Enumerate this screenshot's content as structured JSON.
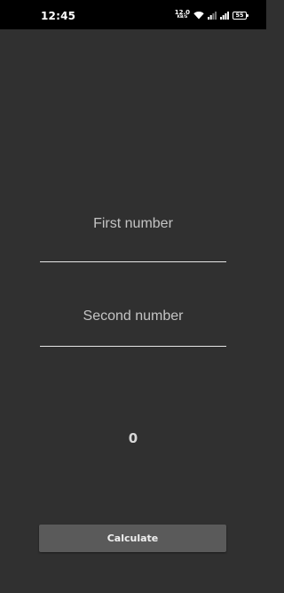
{
  "status_bar": {
    "time": "12:45",
    "net_speed_value": "12.0",
    "net_speed_unit": "KB/S",
    "battery_level": "55",
    "icons": [
      "wifi-icon",
      "signal-icon",
      "signal-icon",
      "battery-icon"
    ]
  },
  "form": {
    "first_number_placeholder": "First number",
    "first_number_value": "",
    "second_number_placeholder": "Second number",
    "second_number_value": ""
  },
  "result": {
    "value": "0"
  },
  "actions": {
    "calculate_label": "Calculate"
  },
  "colors": {
    "background": "#303030",
    "status_bar": "#000000",
    "button": "#5a5a5a",
    "text": "#dcdcdc"
  }
}
